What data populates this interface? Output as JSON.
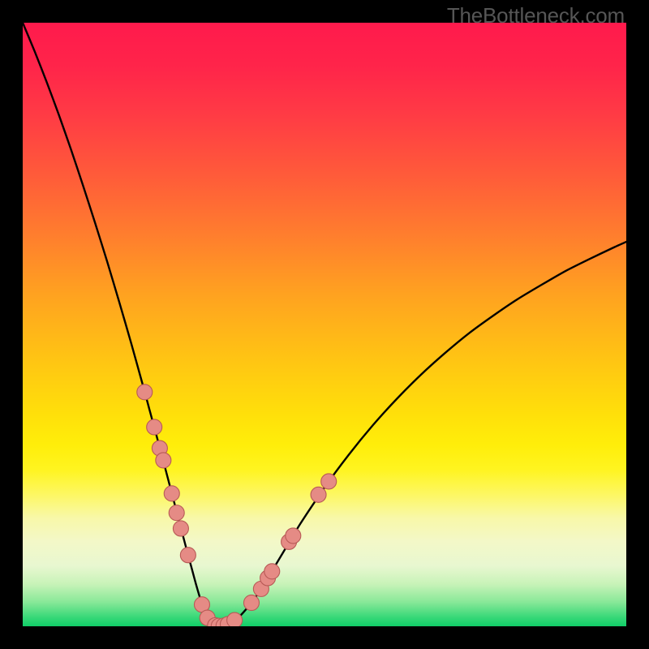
{
  "watermark": "TheBottleneck.com",
  "colors": {
    "gradient_stops": [
      {
        "offset": 0.0,
        "color": "#ff1a4c"
      },
      {
        "offset": 0.07,
        "color": "#ff244a"
      },
      {
        "offset": 0.15,
        "color": "#ff3a45"
      },
      {
        "offset": 0.25,
        "color": "#ff5a3a"
      },
      {
        "offset": 0.35,
        "color": "#ff7d2e"
      },
      {
        "offset": 0.45,
        "color": "#ffa220"
      },
      {
        "offset": 0.55,
        "color": "#ffc214"
      },
      {
        "offset": 0.65,
        "color": "#ffe00a"
      },
      {
        "offset": 0.7,
        "color": "#ffee0a"
      },
      {
        "offset": 0.74,
        "color": "#fff420"
      },
      {
        "offset": 0.78,
        "color": "#fdf760"
      },
      {
        "offset": 0.82,
        "color": "#f8f8a8"
      },
      {
        "offset": 0.86,
        "color": "#f3f8c8"
      },
      {
        "offset": 0.9,
        "color": "#e8f7d0"
      },
      {
        "offset": 0.93,
        "color": "#c8f3b8"
      },
      {
        "offset": 0.96,
        "color": "#88e898"
      },
      {
        "offset": 0.985,
        "color": "#38d878"
      },
      {
        "offset": 1.0,
        "color": "#10ce68"
      }
    ],
    "curve": "#000000",
    "marker_fill": "#e58b85",
    "marker_stroke": "#b85a56"
  },
  "chart_data": {
    "type": "line",
    "title": "",
    "xlabel": "",
    "ylabel": "",
    "xlim": [
      0,
      100
    ],
    "ylim": [
      0,
      100
    ],
    "series": [
      {
        "name": "bottleneck-curve",
        "x": [
          0,
          2,
          4,
          6,
          8,
          10,
          12,
          14,
          16,
          18,
          20,
          21,
          22,
          23,
          24,
          25,
          26,
          27,
          28,
          28.7,
          29.4,
          30,
          30.6,
          31.2,
          31.9,
          32.7,
          33.6,
          34.6,
          36,
          38,
          40,
          43,
          46,
          50,
          54,
          58,
          62,
          66,
          70,
          74,
          78,
          82,
          86,
          90,
          94,
          98,
          100
        ],
        "y": [
          100,
          95.2,
          90.1,
          84.7,
          79.0,
          73.0,
          66.8,
          60.4,
          53.7,
          46.8,
          39.6,
          35.9,
          32.2,
          28.5,
          24.7,
          20.9,
          17.1,
          13.3,
          9.6,
          7.0,
          4.6,
          2.8,
          1.4,
          0.6,
          0.15,
          0.0,
          0.15,
          0.65,
          1.7,
          4.0,
          7.0,
          12.0,
          17.0,
          23.0,
          28.4,
          33.3,
          37.7,
          41.7,
          45.3,
          48.6,
          51.5,
          54.2,
          56.6,
          58.9,
          60.9,
          62.8,
          63.7
        ]
      }
    ],
    "markers": [
      {
        "x": 20.2,
        "y": 38.8
      },
      {
        "x": 21.8,
        "y": 33.0
      },
      {
        "x": 22.7,
        "y": 29.5
      },
      {
        "x": 23.3,
        "y": 27.5
      },
      {
        "x": 24.7,
        "y": 22.0
      },
      {
        "x": 25.5,
        "y": 18.8
      },
      {
        "x": 26.2,
        "y": 16.2
      },
      {
        "x": 27.4,
        "y": 11.8
      },
      {
        "x": 29.7,
        "y": 3.6
      },
      {
        "x": 30.6,
        "y": 1.4
      },
      {
        "x": 31.9,
        "y": 0.15
      },
      {
        "x": 32.5,
        "y": 0.05
      },
      {
        "x": 33.3,
        "y": 0.1
      },
      {
        "x": 34.0,
        "y": 0.35
      },
      {
        "x": 35.1,
        "y": 1.0
      },
      {
        "x": 37.9,
        "y": 3.9
      },
      {
        "x": 39.5,
        "y": 6.2
      },
      {
        "x": 40.6,
        "y": 8.0
      },
      {
        "x": 41.3,
        "y": 9.1
      },
      {
        "x": 44.1,
        "y": 14.0
      },
      {
        "x": 44.8,
        "y": 15.0
      },
      {
        "x": 49.0,
        "y": 21.8
      },
      {
        "x": 50.7,
        "y": 24.0
      }
    ],
    "marker_radius_px": 9.5
  }
}
